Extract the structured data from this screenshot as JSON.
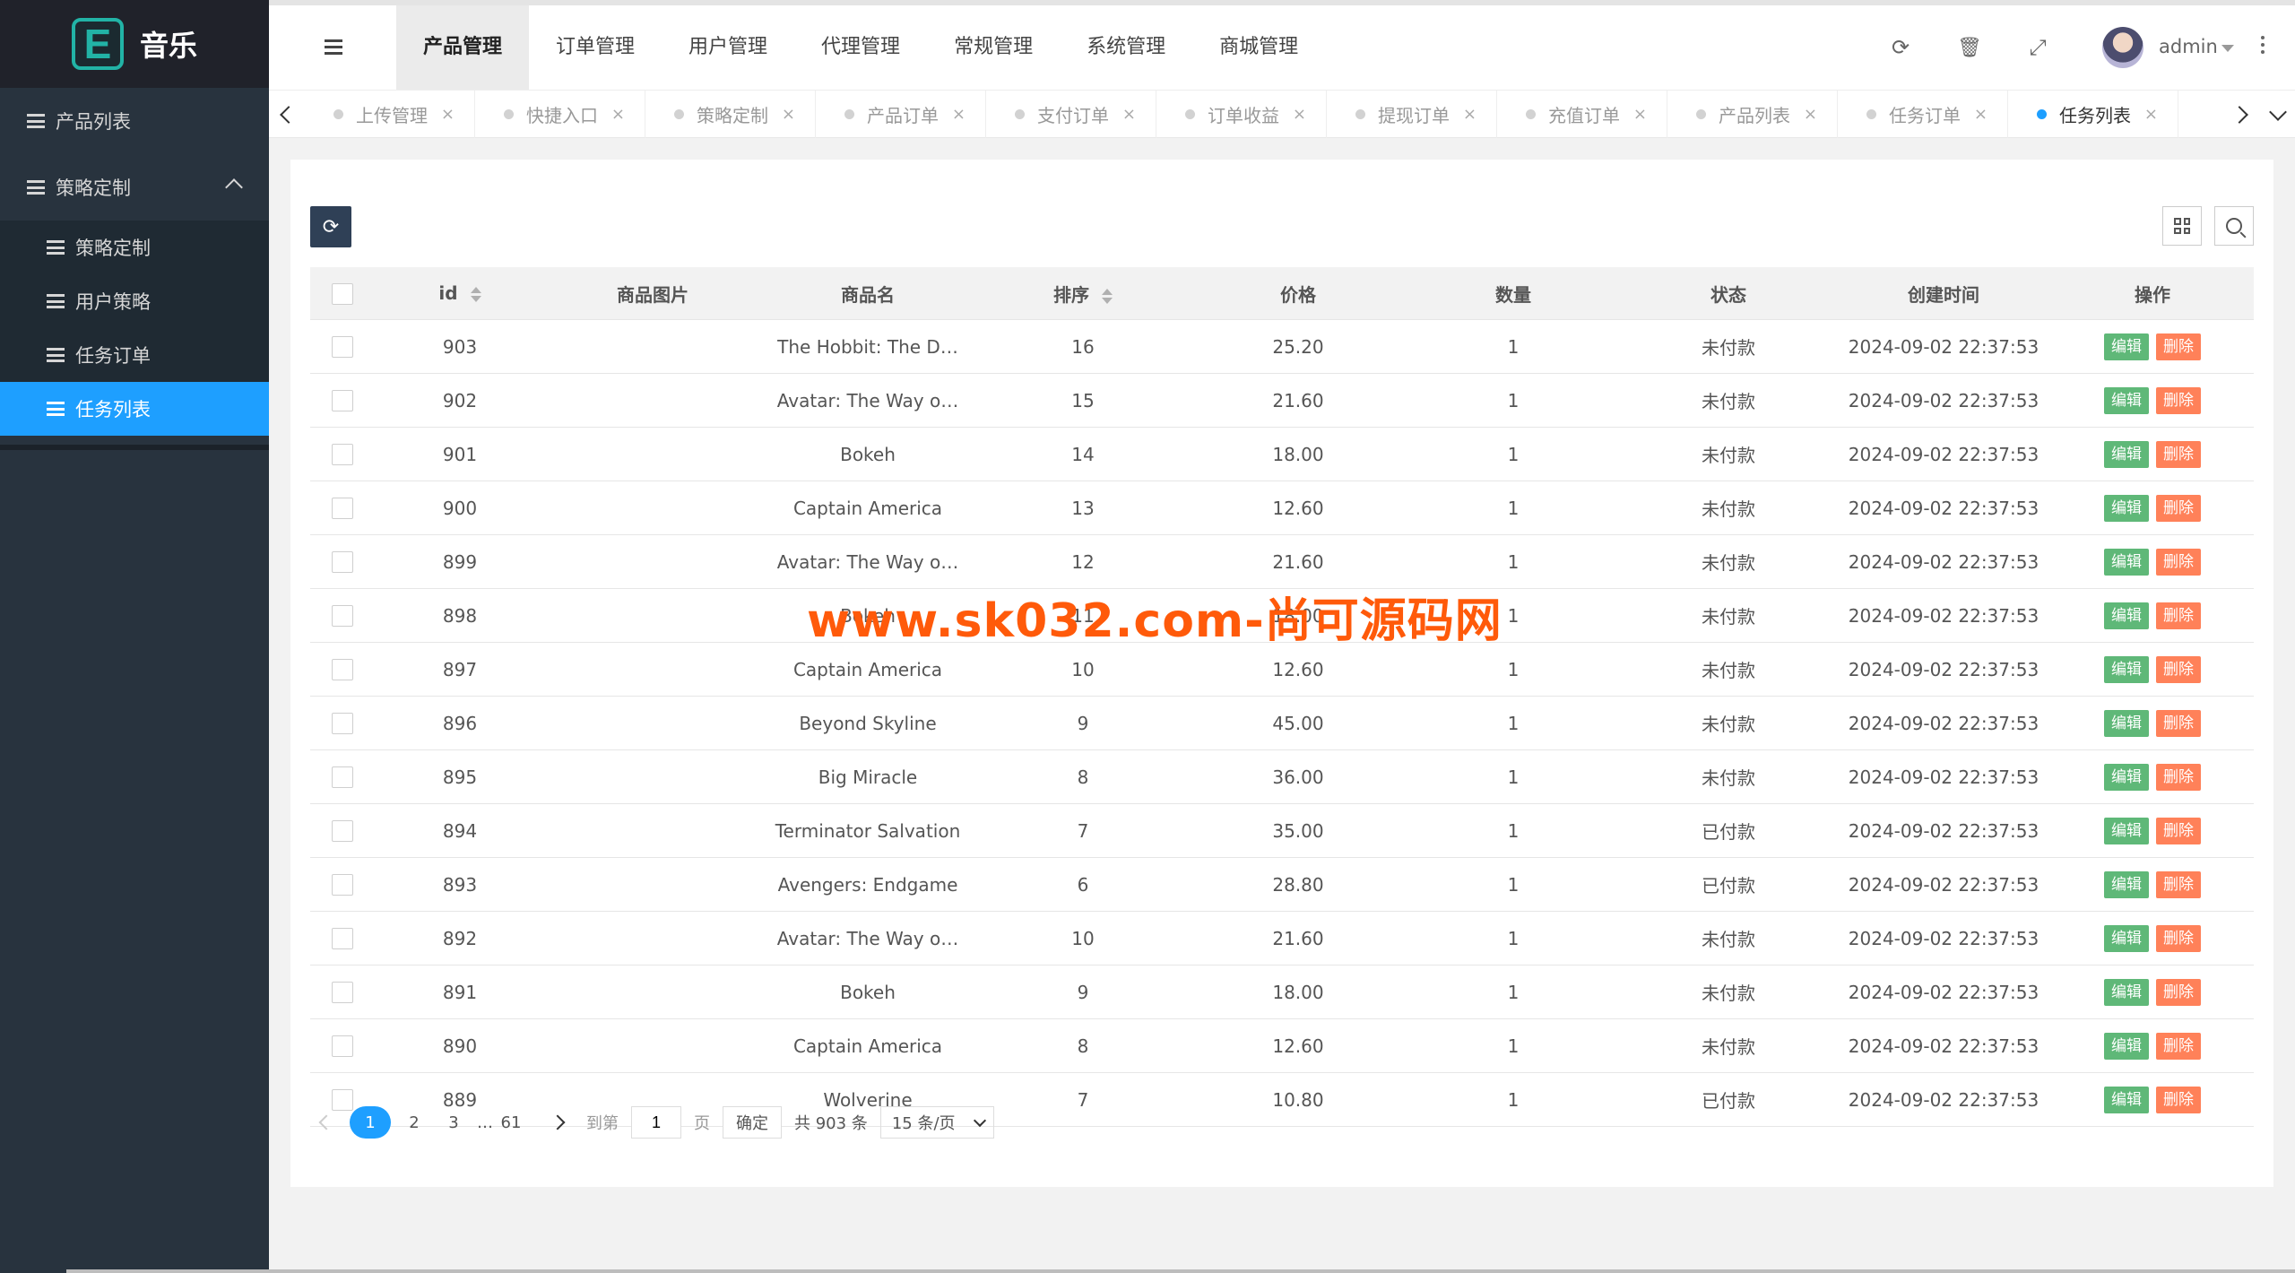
{
  "sidebar": {
    "logo_letter": "E",
    "app_name": "音乐",
    "items": [
      {
        "label": "产品列表"
      },
      {
        "label": "策略定制"
      }
    ],
    "sub_items": [
      {
        "label": "策略定制"
      },
      {
        "label": "用户策略"
      },
      {
        "label": "任务订单"
      },
      {
        "label": "任务列表"
      }
    ]
  },
  "topnav": [
    "产品管理",
    "订单管理",
    "用户管理",
    "代理管理",
    "常规管理",
    "系统管理",
    "商城管理"
  ],
  "header": {
    "user": "admin"
  },
  "tabs": [
    "上传管理",
    "快捷入口",
    "策略定制",
    "产品订单",
    "支付订单",
    "订单收益",
    "提现订单",
    "充值订单",
    "产品列表",
    "任务订单",
    "任务列表"
  ],
  "table": {
    "headers": [
      "id",
      "商品图片",
      "商品名",
      "排序",
      "价格",
      "数量",
      "状态",
      "创建时间",
      "操作"
    ],
    "edit_label": "编辑",
    "delete_label": "删除",
    "rows": [
      {
        "id": "903",
        "name": "The Hobbit: The D…",
        "sort": "16",
        "price": "25.20",
        "qty": "1",
        "status": "未付款",
        "created": "2024-09-02 22:37:53"
      },
      {
        "id": "902",
        "name": "Avatar: The Way o…",
        "sort": "15",
        "price": "21.60",
        "qty": "1",
        "status": "未付款",
        "created": "2024-09-02 22:37:53"
      },
      {
        "id": "901",
        "name": "Bokeh",
        "sort": "14",
        "price": "18.00",
        "qty": "1",
        "status": "未付款",
        "created": "2024-09-02 22:37:53"
      },
      {
        "id": "900",
        "name": "Captain America",
        "sort": "13",
        "price": "12.60",
        "qty": "1",
        "status": "未付款",
        "created": "2024-09-02 22:37:53"
      },
      {
        "id": "899",
        "name": "Avatar: The Way o…",
        "sort": "12",
        "price": "21.60",
        "qty": "1",
        "status": "未付款",
        "created": "2024-09-02 22:37:53"
      },
      {
        "id": "898",
        "name": "Bokeh",
        "sort": "11",
        "price": "18.00",
        "qty": "1",
        "status": "未付款",
        "created": "2024-09-02 22:37:53"
      },
      {
        "id": "897",
        "name": "Captain America",
        "sort": "10",
        "price": "12.60",
        "qty": "1",
        "status": "未付款",
        "created": "2024-09-02 22:37:53"
      },
      {
        "id": "896",
        "name": "Beyond Skyline",
        "sort": "9",
        "price": "45.00",
        "qty": "1",
        "status": "未付款",
        "created": "2024-09-02 22:37:53"
      },
      {
        "id": "895",
        "name": "Big Miracle",
        "sort": "8",
        "price": "36.00",
        "qty": "1",
        "status": "未付款",
        "created": "2024-09-02 22:37:53"
      },
      {
        "id": "894",
        "name": "Terminator Salvation",
        "sort": "7",
        "price": "35.00",
        "qty": "1",
        "status": "已付款",
        "created": "2024-09-02 22:37:53"
      },
      {
        "id": "893",
        "name": "Avengers: Endgame",
        "sort": "6",
        "price": "28.80",
        "qty": "1",
        "status": "已付款",
        "created": "2024-09-02 22:37:53"
      },
      {
        "id": "892",
        "name": "Avatar: The Way o…",
        "sort": "10",
        "price": "21.60",
        "qty": "1",
        "status": "未付款",
        "created": "2024-09-02 22:37:53"
      },
      {
        "id": "891",
        "name": "Bokeh",
        "sort": "9",
        "price": "18.00",
        "qty": "1",
        "status": "未付款",
        "created": "2024-09-02 22:37:53"
      },
      {
        "id": "890",
        "name": "Captain America",
        "sort": "8",
        "price": "12.60",
        "qty": "1",
        "status": "未付款",
        "created": "2024-09-02 22:37:53"
      },
      {
        "id": "889",
        "name": "Wolverine",
        "sort": "7",
        "price": "10.80",
        "qty": "1",
        "status": "已付款",
        "created": "2024-09-02 22:37:53"
      }
    ]
  },
  "pager": {
    "pages": [
      "1",
      "2",
      "3"
    ],
    "ellipsis": "…",
    "last_page": "61",
    "goto_label": "到第",
    "goto_value": "1",
    "page_unit": "页",
    "confirm": "确定",
    "total": "共 903 条",
    "per_page": "15 条/页"
  },
  "watermark": "www.sk032.com-尚可源码网",
  "colors": {
    "accent": "#1e9fff",
    "sidebar": "#28333e",
    "edit": "#5fb878",
    "delete": "#ff5722"
  }
}
